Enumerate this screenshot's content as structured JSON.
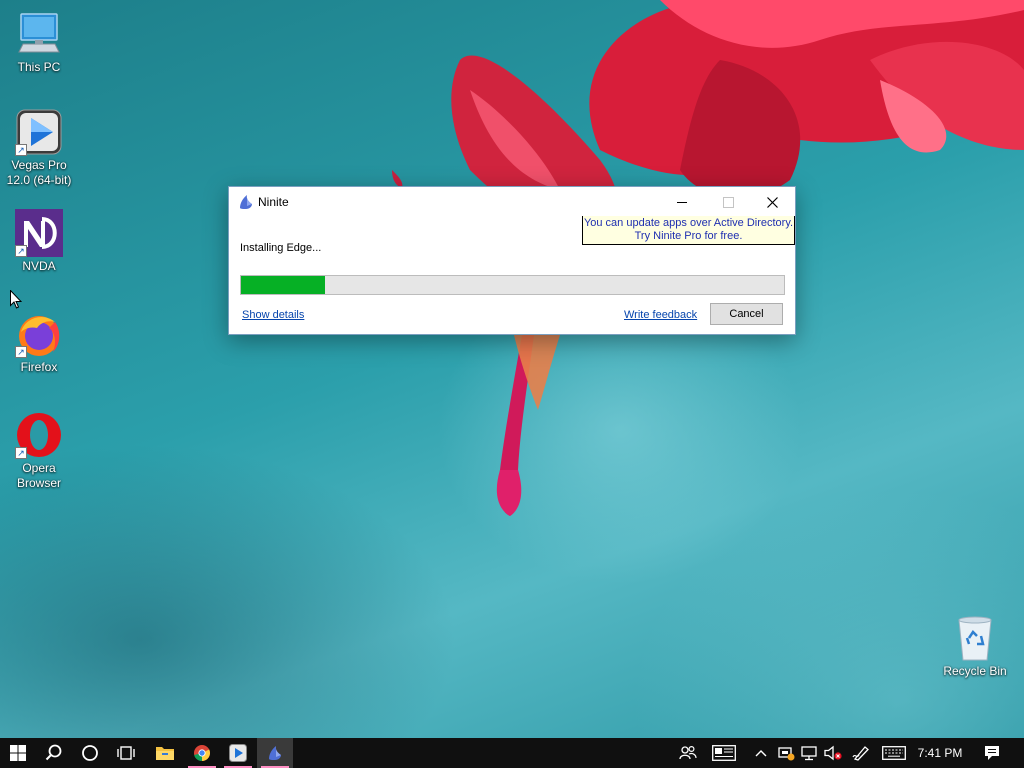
{
  "desktop": {
    "icons": [
      {
        "label": "This PC",
        "icon": "this-pc-icon"
      },
      {
        "label": "Vegas Pro 12.0 (64-bit)",
        "icon": "vegas-pro-icon"
      },
      {
        "label": "NVDA",
        "icon": "nvda-icon"
      },
      {
        "label": "Firefox",
        "icon": "firefox-icon"
      },
      {
        "label": "Opera Browser",
        "icon": "opera-icon"
      },
      {
        "label": "Recycle Bin",
        "icon": "recycle-bin-icon"
      }
    ]
  },
  "ninite_window": {
    "title": "Ninite",
    "promo_line1": "You can update apps over Active Directory.",
    "promo_line2": "Try Ninite Pro for free.",
    "status": "Installing Edge...",
    "progress_fraction": 0.155,
    "progress_color": "#06b025",
    "show_details": "Show details",
    "write_feedback": "Write feedback",
    "cancel": "Cancel",
    "caption_buttons": [
      "minimize-icon",
      "maximize-icon",
      "close-icon"
    ]
  },
  "taskbar": {
    "pinned": [
      "windows-start-icon",
      "search-icon",
      "cortana-icon",
      "task-view-icon",
      "file-explorer-icon",
      "chrome-icon",
      "vegas-pro-icon",
      "ninite-icon"
    ],
    "tray_icons": [
      "people-icon",
      "news-icon",
      "chevron-up-icon",
      "network-warning-icon",
      "display-icon",
      "volume-muted-icon",
      "pen-icon",
      "keyboard-icon",
      "notifications-icon"
    ],
    "time": "7:41 PM"
  },
  "colors": {
    "taskbar_bg": "#101010",
    "promo_bg": "#ffffe1",
    "promo_text": "#1f2fb0",
    "link": "#0645ad"
  }
}
